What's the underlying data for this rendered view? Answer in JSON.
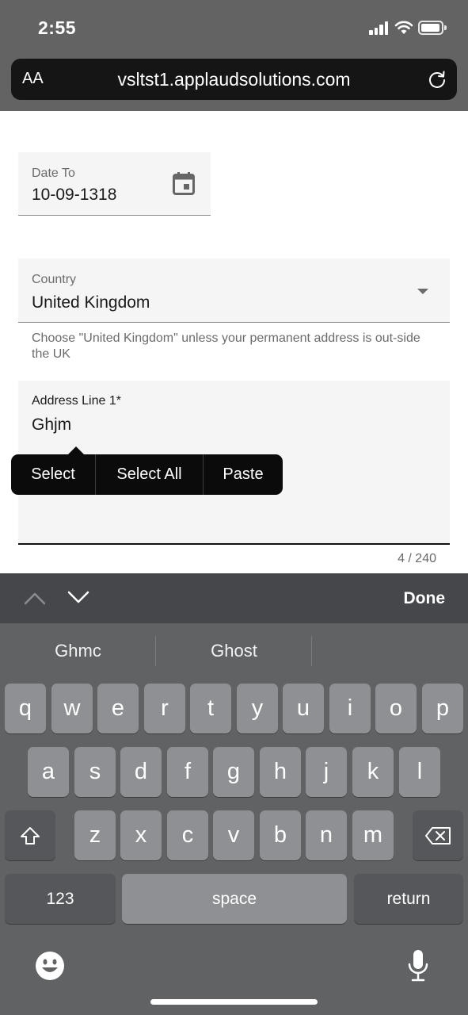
{
  "status_bar": {
    "time": "2:55"
  },
  "browser": {
    "text_size_label": "AA",
    "url": "vsltst1.applaudsolutions.com"
  },
  "form": {
    "date_to": {
      "label": "Date To",
      "value": "10-09-1318"
    },
    "country": {
      "label": "Country",
      "value": "United Kingdom"
    },
    "country_hint": "Choose \"United Kingdom\" unless your permanent address is out-side the UK",
    "address_line1": {
      "label": "Address Line 1*",
      "value": "Ghjm",
      "counter": "4 / 240"
    }
  },
  "edit_menu": {
    "select": "Select",
    "select_all": "Select All",
    "paste": "Paste"
  },
  "keyboard": {
    "done_label": "Done",
    "suggestions": [
      "Ghmc",
      "Ghost"
    ],
    "row1": [
      "q",
      "w",
      "e",
      "r",
      "t",
      "y",
      "u",
      "i",
      "o",
      "p"
    ],
    "row2": [
      "a",
      "s",
      "d",
      "f",
      "g",
      "h",
      "j",
      "k",
      "l"
    ],
    "row3": [
      "z",
      "x",
      "c",
      "v",
      "b",
      "n",
      "m"
    ],
    "numbers_label": "123",
    "space_label": "space",
    "return_label": "return"
  },
  "colors": {
    "page_bg": "#ffffff",
    "field_bg": "#f5f5f5",
    "keyboard_bg": "#606264",
    "key_bg": "#8e9093",
    "menu_bg": "#0b0b0b"
  }
}
